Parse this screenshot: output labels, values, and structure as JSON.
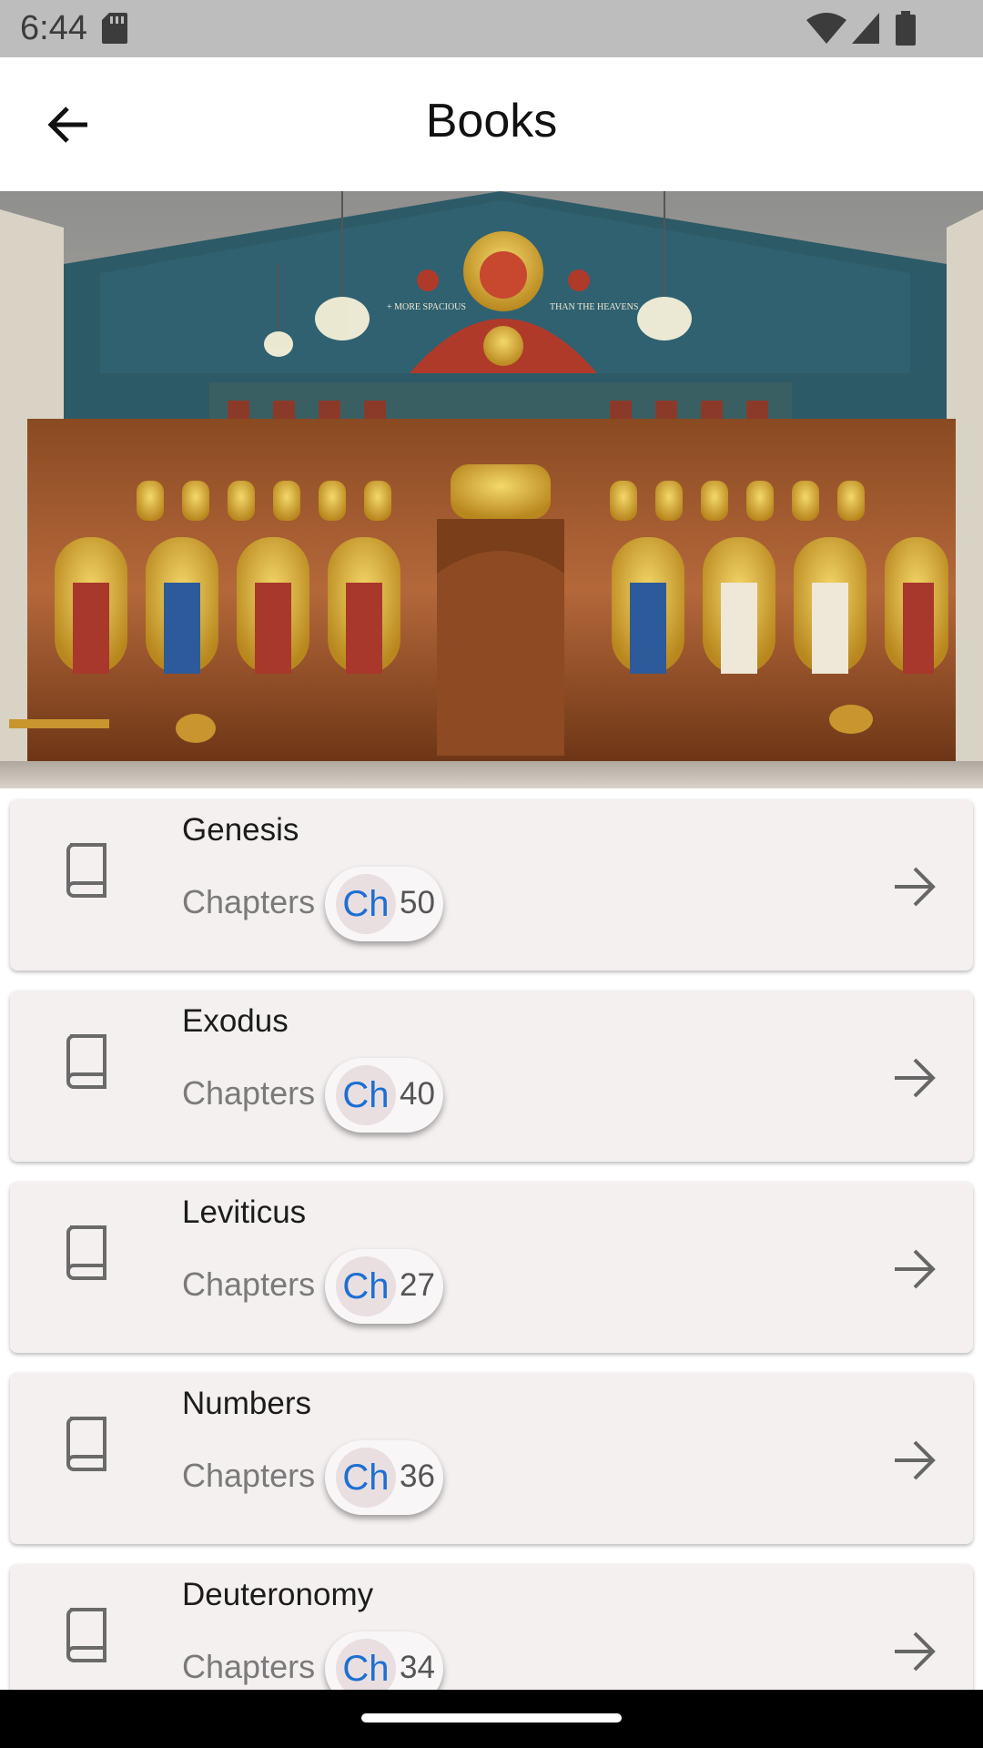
{
  "status_bar": {
    "time": "6:44",
    "icons": [
      "sd-card-icon",
      "wifi-icon",
      "signal-icon",
      "battery-icon"
    ]
  },
  "app_bar": {
    "title": "Books",
    "back_icon": "arrow-back-icon"
  },
  "hero": {
    "image": "church-iconostasis-photo",
    "banner_left": "+ MORE SPACIOUS",
    "banner_right": "THAN THE HEAVENS"
  },
  "colors": {
    "card_bg": "#f4f0ef",
    "chip_accent": "#1e6fd1",
    "status_bar": "#bdbdbd"
  },
  "books": [
    {
      "title": "Genesis",
      "chapters_label": "Chapters",
      "chip_prefix": "Ch",
      "count": "50"
    },
    {
      "title": "Exodus",
      "chapters_label": "Chapters",
      "chip_prefix": "Ch",
      "count": "40"
    },
    {
      "title": "Leviticus",
      "chapters_label": "Chapters",
      "chip_prefix": "Ch",
      "count": "27"
    },
    {
      "title": "Numbers",
      "chapters_label": "Chapters",
      "chip_prefix": "Ch",
      "count": "36"
    },
    {
      "title": "Deuteronomy",
      "chapters_label": "Chapters",
      "chip_prefix": "Ch",
      "count": "34"
    }
  ]
}
